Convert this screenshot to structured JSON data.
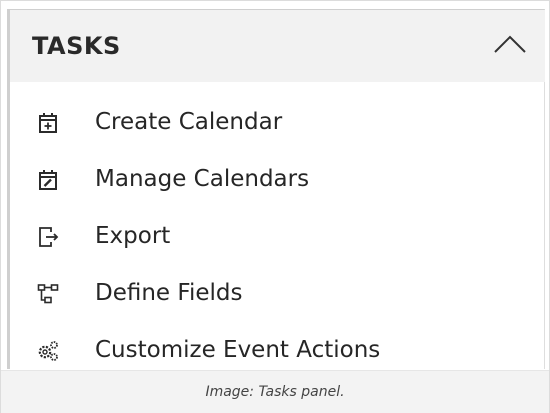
{
  "panel": {
    "title": "TASKS",
    "collapse_icon": "chevron-up-icon",
    "items": [
      {
        "label": "Create Calendar",
        "icon": "calendar-add-icon"
      },
      {
        "label": "Manage Calendars",
        "icon": "calendar-edit-icon"
      },
      {
        "label": "Export",
        "icon": "export-icon"
      },
      {
        "label": "Define Fields",
        "icon": "hierarchy-icon"
      },
      {
        "label": "Customize Event Actions",
        "icon": "gears-icon"
      }
    ]
  },
  "caption": "Image: Tasks panel.",
  "colors": {
    "header_bg": "#f2f2f2",
    "text": "#262626",
    "caption_bg": "#f3f3f3"
  }
}
